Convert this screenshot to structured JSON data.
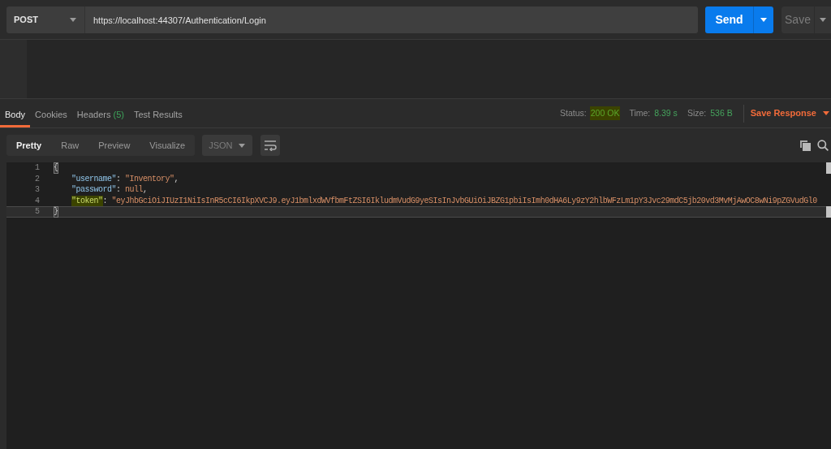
{
  "request": {
    "method": "POST",
    "url": "https://localhost:44307/Authentication/Login",
    "send_label": "Send",
    "save_label": "Save"
  },
  "response": {
    "tabs": [
      {
        "label": "Body",
        "selected": true
      },
      {
        "label": "Cookies",
        "selected": false
      },
      {
        "label": "Headers",
        "count": "(5)",
        "selected": false
      },
      {
        "label": "Test Results",
        "selected": false
      }
    ],
    "metrics": [
      {
        "label": "Status:",
        "value": "200 OK",
        "highlighted": true
      },
      {
        "label": "Time:",
        "value": "8.39 s",
        "highlighted": false
      },
      {
        "label": "Size:",
        "value": "536 B",
        "highlighted": false
      }
    ],
    "save_response": "Save Response"
  },
  "viewer": {
    "modes": [
      {
        "label": "Pretty",
        "selected": true
      },
      {
        "label": "Raw",
        "selected": false
      },
      {
        "label": "Preview",
        "selected": false
      },
      {
        "label": "Visualize",
        "selected": false
      }
    ],
    "format": "JSON",
    "lines": [
      {
        "number": "1",
        "kind": "open",
        "current": false,
        "tokens": [
          {
            "kind": "brace",
            "text": "{",
            "highlighted": true
          }
        ]
      },
      {
        "number": "2",
        "kind": "member",
        "current": false,
        "tokens": [
          {
            "kind": "key",
            "text": "\"username\"",
            "highlighted": false
          },
          {
            "kind": "punct",
            "text": ": ",
            "highlighted": false
          },
          {
            "kind": "string",
            "text": "\"Inventory\"",
            "highlighted": false
          },
          {
            "kind": "punct",
            "text": ",",
            "highlighted": false
          }
        ]
      },
      {
        "number": "3",
        "kind": "member",
        "current": false,
        "tokens": [
          {
            "kind": "key",
            "text": "\"password\"",
            "highlighted": false
          },
          {
            "kind": "punct",
            "text": ": ",
            "highlighted": false
          },
          {
            "kind": "literal",
            "text": "null",
            "highlighted": false
          },
          {
            "kind": "punct",
            "text": ",",
            "highlighted": false
          }
        ]
      },
      {
        "number": "4",
        "kind": "member",
        "current": false,
        "tokens": [
          {
            "kind": "key",
            "text": "\"token\"",
            "highlighted": true
          },
          {
            "kind": "punct",
            "text": ": ",
            "highlighted": false
          },
          {
            "kind": "string",
            "text": "\"eyJhbGciOiJIUzI1NiIsInR5cCI6IkpXVCJ9.eyJ1bmlxdWVfbmFtZSI6IkludmVudG9yeSIsInJvbGUiOiJBZG1pbiIsImh0dHA6Ly9zY2hlbWFzLm1pY3Jvc29mdC5jb20vd3MvMjAwOC8wNi9pZGVudGl0",
            "highlighted": false
          }
        ]
      },
      {
        "number": "5",
        "kind": "close",
        "current": true,
        "tokens": [
          {
            "kind": "brace",
            "text": "}",
            "highlighted": true
          }
        ]
      }
    ]
  }
}
